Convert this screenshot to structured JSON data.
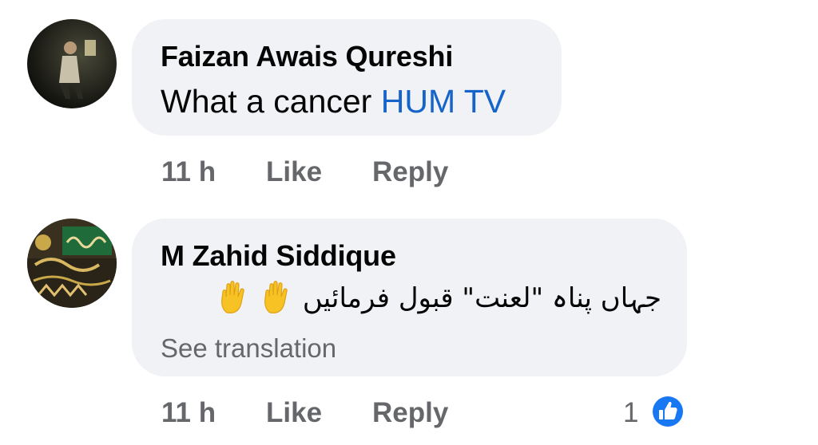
{
  "comments": [
    {
      "author": "Faizan Awais Qureshi",
      "text_prefix": "What a cancer ",
      "mention": "HUM TV",
      "time": "11 h",
      "like_label": "Like",
      "reply_label": "Reply",
      "avatar_icon": "profile-photo-dark"
    },
    {
      "author": "M Zahid Siddique",
      "text": "جہاں پناہ \"لعنت\" قبول فرمائیں",
      "emoji": [
        "raised-hand",
        "raised-hand"
      ],
      "see_translation": "See translation",
      "time": "11 h",
      "like_label": "Like",
      "reply_label": "Reply",
      "reaction_count": "1",
      "reaction_icon": "thumbs-up-icon",
      "avatar_icon": "profile-photo-calligraphy"
    }
  ],
  "colors": {
    "bubble": "#f0f2f5",
    "text": "#050505",
    "secondary": "#65676b",
    "mention": "#1664c9",
    "like_badge": "#1877f2"
  }
}
